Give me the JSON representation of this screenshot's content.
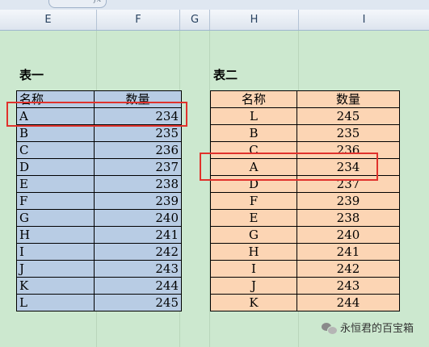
{
  "columns": [
    "E",
    "F",
    "G",
    "H",
    "I"
  ],
  "table1": {
    "title": "表一",
    "header": {
      "name": "名称",
      "qty": "数量"
    },
    "rows": [
      {
        "name": "A",
        "qty": "234"
      },
      {
        "name": "B",
        "qty": "235"
      },
      {
        "name": "C",
        "qty": "236"
      },
      {
        "name": "D",
        "qty": "237"
      },
      {
        "name": "E",
        "qty": "238"
      },
      {
        "name": "F",
        "qty": "239"
      },
      {
        "name": "G",
        "qty": "240"
      },
      {
        "name": "H",
        "qty": "241"
      },
      {
        "name": "I",
        "qty": "242"
      },
      {
        "name": "J",
        "qty": "243"
      },
      {
        "name": "K",
        "qty": "244"
      },
      {
        "name": "L",
        "qty": "245"
      }
    ]
  },
  "table2": {
    "title": "表二",
    "header": {
      "name": "名称",
      "qty": "数量"
    },
    "rows": [
      {
        "name": "L",
        "qty": "245"
      },
      {
        "name": "B",
        "qty": "235"
      },
      {
        "name": "C",
        "qty": "236"
      },
      {
        "name": "A",
        "qty": "234"
      },
      {
        "name": "D",
        "qty": "237"
      },
      {
        "name": "F",
        "qty": "239"
      },
      {
        "name": "E",
        "qty": "238"
      },
      {
        "name": "G",
        "qty": "240"
      },
      {
        "name": "H",
        "qty": "241"
      },
      {
        "name": "I",
        "qty": "242"
      },
      {
        "name": "J",
        "qty": "243"
      },
      {
        "name": "K",
        "qty": "244"
      }
    ]
  },
  "watermark": {
    "text": "永恒君的百宝箱",
    "icon": "wechat-icon"
  },
  "colors": {
    "sheet_background": "#cce8cf",
    "table1_fill": "#b8cce4",
    "table2_fill": "#fcd5b4",
    "highlight_border": "#e0322c"
  }
}
